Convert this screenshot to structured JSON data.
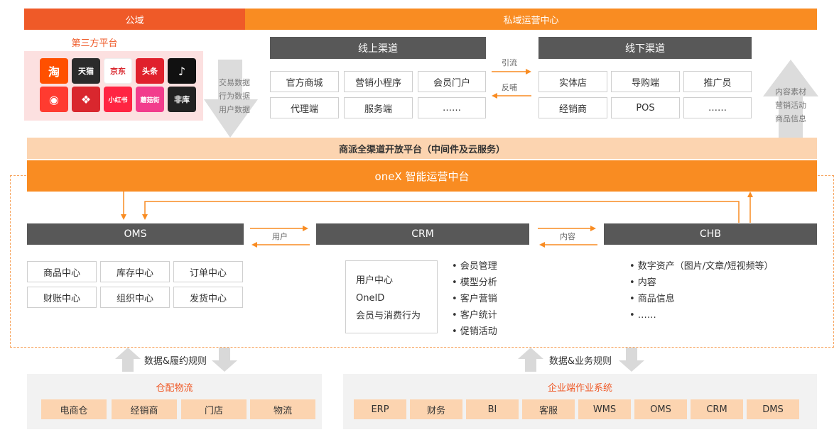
{
  "header": {
    "public_domain": "公域",
    "private_domain": "私域运营中心"
  },
  "third_party": {
    "title": "第三方平台",
    "apps": [
      {
        "name": "taobao-icon",
        "glyph": "淘",
        "color": "#ff5000"
      },
      {
        "name": "tmall-icon",
        "glyph": "天猫",
        "color": "#2b2b2b"
      },
      {
        "name": "jd-icon",
        "glyph": "京东",
        "color": "#ffffff"
      },
      {
        "name": "toutiao-icon",
        "glyph": "头条",
        "color": "#e0202c"
      },
      {
        "name": "douyin-icon",
        "glyph": "♪",
        "color": "#111111"
      },
      {
        "name": "taobao-live-icon",
        "glyph": "◉",
        "color": "#ff3b30"
      },
      {
        "name": "pinduoduo-icon",
        "glyph": "❖",
        "color": "#d9272e"
      },
      {
        "name": "xiaohongshu-icon",
        "glyph": "小红书",
        "color": "#ff2442"
      },
      {
        "name": "mogujie-icon",
        "glyph": "蘑菇街",
        "color": "#f23c8c"
      },
      {
        "name": "feiku-icon",
        "glyph": "非库",
        "color": "#222222"
      }
    ]
  },
  "data_flow_left": [
    "交易数据",
    "行为数据",
    "用户数据"
  ],
  "online": {
    "title": "线上渠道",
    "items": [
      "官方商城",
      "营销小程序",
      "会员门户",
      "代理端",
      "服务端",
      "……"
    ]
  },
  "offline": {
    "title": "线下渠道",
    "items": [
      "实体店",
      "导购端",
      "推广员",
      "经销商",
      "POS",
      "……"
    ]
  },
  "channel_arrows": {
    "to_offline": "引流",
    "to_online": "反哺"
  },
  "data_flow_right": [
    "内容素材",
    "营销活动",
    "商品信息"
  ],
  "platform": {
    "middleware": "商派全渠道开放平台（中间件及云服务）",
    "onex": "oneX 智能运营中台"
  },
  "oms": {
    "title": "OMS",
    "items": [
      "商品中心",
      "库存中心",
      "订单中心",
      "财账中心",
      "组织中心",
      "发货中心"
    ]
  },
  "crm": {
    "title": "CRM",
    "box_items": [
      "用户中心",
      "OneID",
      "会员与消费行为"
    ],
    "bullets": [
      "• 会员管理",
      "• 模型分析",
      "• 客户营销",
      "• 客户统计",
      "• 促销活动"
    ]
  },
  "chb": {
    "title": "CHB",
    "bullets": [
      "• 数字资产（图片/文章/短视频等）",
      "• 内容",
      "• 商品信息",
      "• ……"
    ]
  },
  "mid_arrows": {
    "user": "用户",
    "content": "内容"
  },
  "bottom_left": {
    "rule": "数据&履约规则",
    "title": "仓配物流",
    "items": [
      "电商仓",
      "经销商",
      "门店",
      "物流"
    ]
  },
  "bottom_right": {
    "rule": "数据&业务规则",
    "title": "企业端作业系统",
    "items": [
      "ERP",
      "财务",
      "BI",
      "客服",
      "WMS",
      "OMS",
      "CRM",
      "DMS"
    ]
  }
}
